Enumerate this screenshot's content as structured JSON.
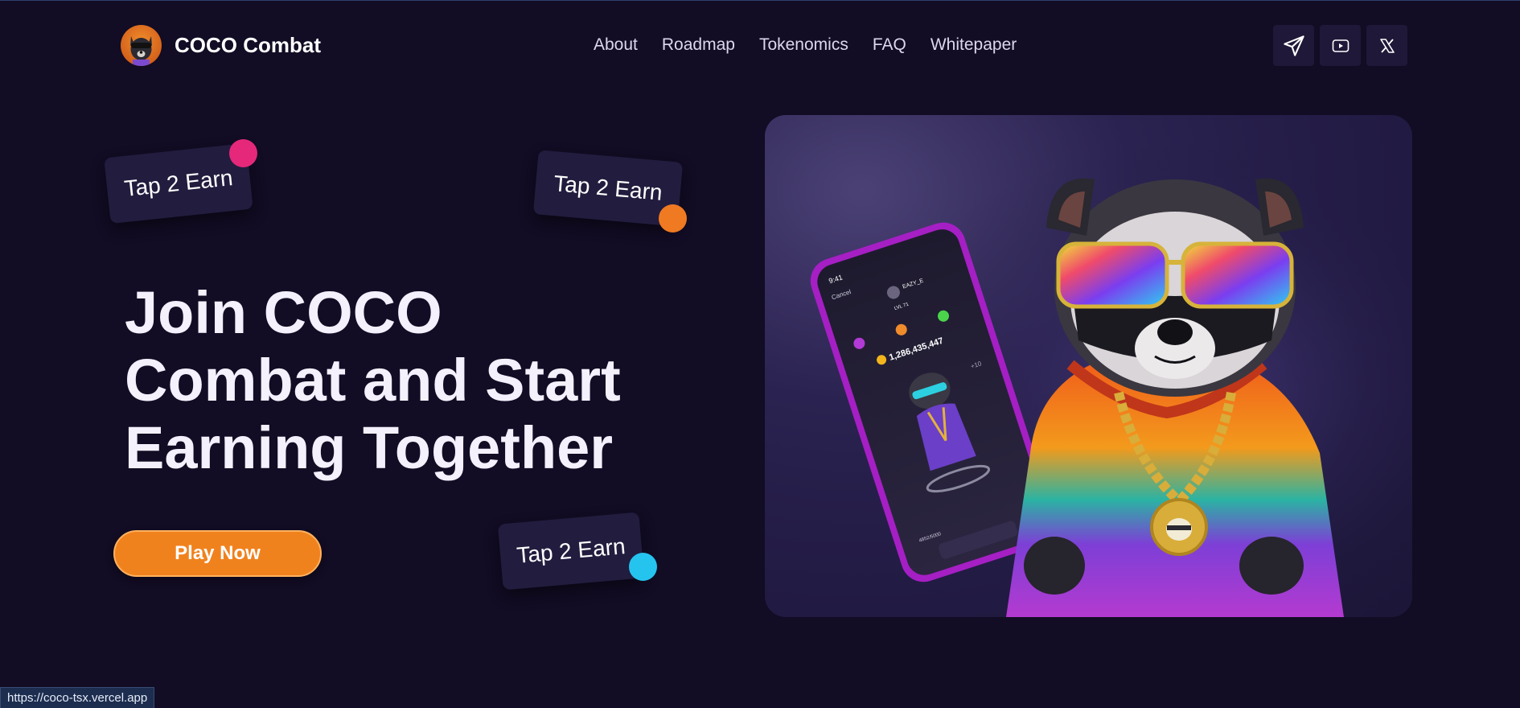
{
  "brand": {
    "name": "COCO Combat"
  },
  "nav": {
    "items": [
      "About",
      "Roadmap",
      "Tokenomics",
      "FAQ",
      "Whitepaper"
    ]
  },
  "socials": {
    "icons": [
      "telegram-icon",
      "youtube-icon",
      "x-icon"
    ]
  },
  "hero": {
    "tags": [
      "Tap 2 Earn",
      "Tap 2 Earn",
      "Tap 2 Earn"
    ],
    "headline": "Join COCO Combat and Start Earning Together",
    "cta": "Play Now",
    "phone": {
      "time": "9:41",
      "cancel": "Cancel",
      "username": "EAZY_E",
      "level": "LVL 71",
      "balance": "1,286,435,447",
      "energy": "4852/5000",
      "bonus": "+10"
    }
  },
  "status_bar": {
    "url": "https://coco-tsx.vercel.app"
  },
  "colors": {
    "background": "#120c24",
    "accent_orange": "#f0821e",
    "dot_pink": "#e6287a",
    "dot_orange": "#f07a21",
    "dot_cyan": "#25c4ef",
    "phone_frame": "#a51fc4"
  }
}
